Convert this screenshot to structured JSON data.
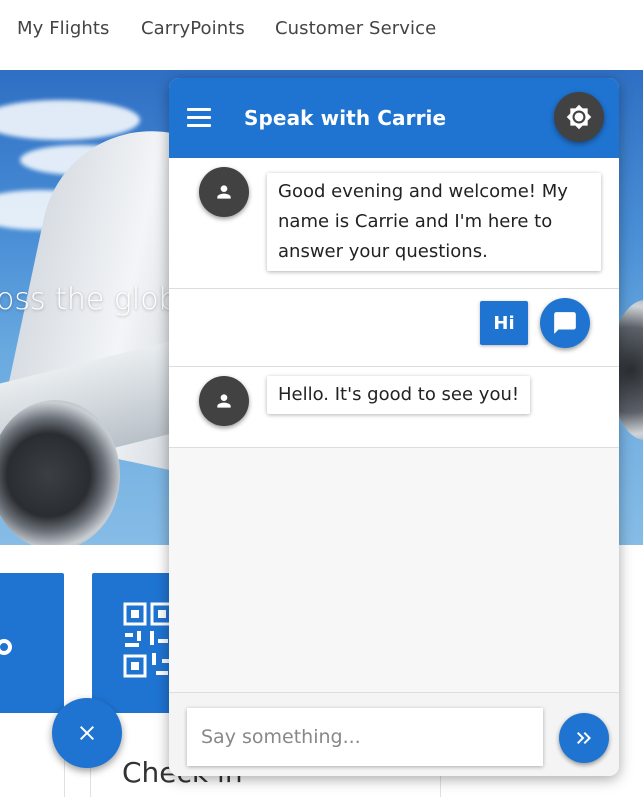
{
  "nav": {
    "items": [
      "My Flights",
      "CarryPoints",
      "Customer Service"
    ]
  },
  "hero": {
    "text": "oss the globe"
  },
  "tiles": {
    "checkin_label": "Check in"
  },
  "chat": {
    "title": "Speak with Carrie",
    "messages": [
      {
        "from": "bot",
        "text": "Good evening and welcome! My name is Carrie and I'm here to answer your questions."
      },
      {
        "from": "user",
        "text": "Hi"
      },
      {
        "from": "bot",
        "text": "Hello. It's good to see you!"
      }
    ],
    "input_placeholder": "Say something...",
    "icons": {
      "menu": "menu-icon",
      "theme": "brightness-icon",
      "bot_avatar": "person-icon",
      "user_avatar": "chat-bubble-icon",
      "send": "double-chevron-right-icon",
      "close": "close-icon"
    }
  },
  "colors": {
    "primary": "#1f74d2",
    "dark": "#424242",
    "background": "#f7f7f7"
  }
}
